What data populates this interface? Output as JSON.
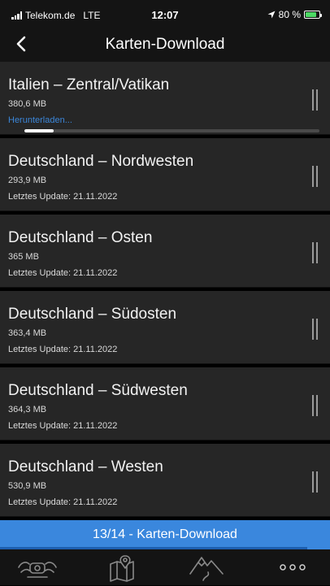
{
  "status_bar": {
    "carrier": "Telekom.de",
    "network": "LTE",
    "time": "12:07",
    "battery": "80 %",
    "battery_level": 0.8,
    "battery_color": "#4cd964"
  },
  "nav": {
    "title": "Karten-Download",
    "back_icon": "chevron-left-icon"
  },
  "maps": [
    {
      "name": "Italien – Zentral/Vatikan",
      "size": "380,6 MB",
      "status": "Herunterladen...",
      "progress": 0.1
    },
    {
      "name": "Deutschland – Nordwesten",
      "size": "293,9 MB",
      "status": "Letztes Update: 21.11.2022"
    },
    {
      "name": "Deutschland – Osten",
      "size": "365 MB",
      "status": "Letztes Update: 21.11.2022"
    },
    {
      "name": "Deutschland – Südosten",
      "size": "363,4 MB",
      "status": "Letztes Update: 21.11.2022"
    },
    {
      "name": "Deutschland – Südwesten",
      "size": "364,3 MB",
      "status": "Letztes Update: 21.11.2022"
    },
    {
      "name": "Deutschland – Westen",
      "size": "530,9 MB",
      "status": "Letztes Update: 21.11.2022"
    }
  ],
  "banner": {
    "text": "13/14 - Karten-Download",
    "progress": 0.93
  },
  "tabs": [
    {
      "icon": "motorcycle-icon"
    },
    {
      "icon": "map-pin-icon"
    },
    {
      "icon": "mountain-icon"
    },
    {
      "icon": "more-icon"
    }
  ],
  "colors": {
    "accent": "#3a87dd",
    "download_status": "#3b86d9",
    "row_background": "#262626"
  }
}
